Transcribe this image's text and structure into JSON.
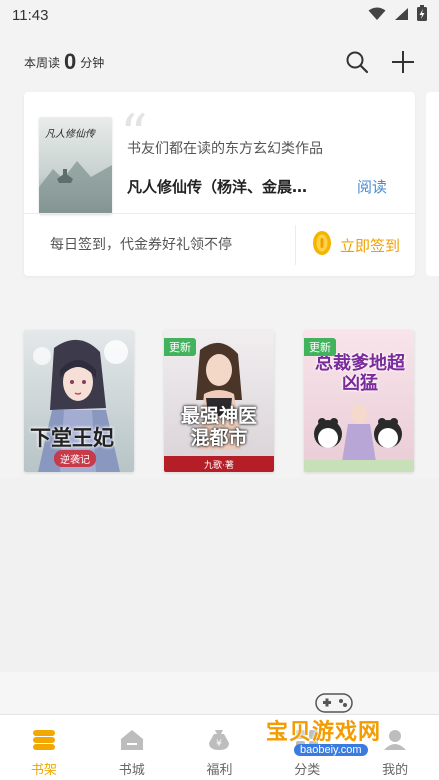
{
  "status_bar": {
    "time": "11:43"
  },
  "header": {
    "weekly_prefix": "本周读",
    "weekly_minutes": "0",
    "weekly_suffix": "分钟"
  },
  "recommendation": {
    "cover_title": "凡人修仙传",
    "tagline": "书友们都在读的东方玄幻类作品",
    "book_title": "凡人修仙传（杨洋、金晨…",
    "read_label": "阅读"
  },
  "signin": {
    "text": "每日签到，代金券好礼领不停",
    "button_label": "立即签到"
  },
  "shelf": {
    "books": [
      {
        "title": "下堂王妃",
        "subtitle": "逆袭记",
        "badge": ""
      },
      {
        "title": "最强神医混都市",
        "author": "九歌·著",
        "badge": "更新"
      },
      {
        "title": "总裁爹地超凶猛",
        "badge": "更新"
      }
    ]
  },
  "bottom_nav": {
    "items": [
      {
        "label": "书架",
        "icon": "bookshelf-icon",
        "active": true
      },
      {
        "label": "书城",
        "icon": "bookstore-icon",
        "active": false
      },
      {
        "label": "福利",
        "icon": "welfare-icon",
        "active": false
      },
      {
        "label": "分类",
        "icon": "category-icon",
        "active": false
      },
      {
        "label": "我的",
        "icon": "profile-icon",
        "active": false
      }
    ]
  },
  "watermark": {
    "name": "宝贝游戏网",
    "url": "baobeiy.com"
  },
  "colors": {
    "accent": "#f2a800",
    "link": "#4a8bd0",
    "update_badge": "#41b35d",
    "background": "#f3f3f3"
  }
}
